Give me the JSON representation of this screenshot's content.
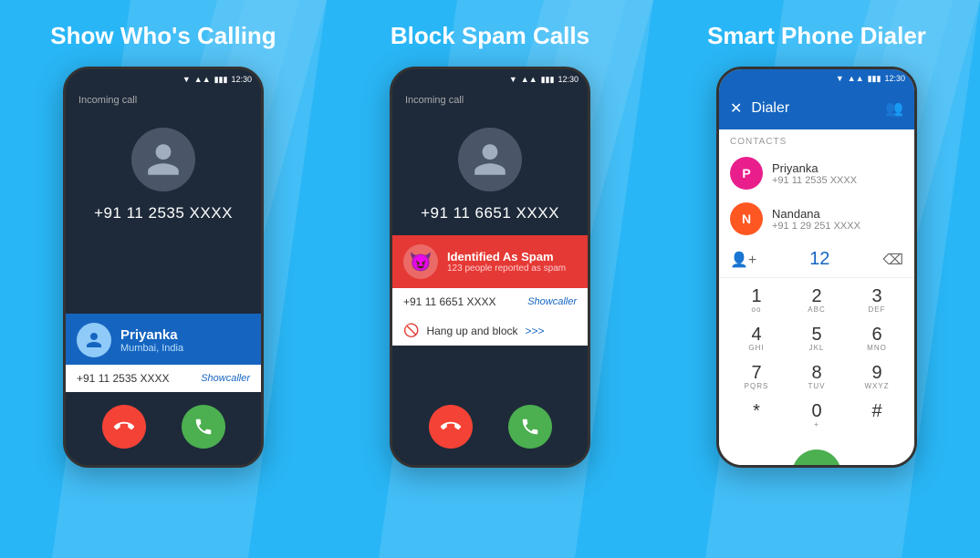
{
  "sections": [
    {
      "title": "Show Who's Calling",
      "phone": {
        "status_time": "12:30",
        "incoming_label": "Incoming call",
        "caller_number": "+91 11 2535 XXXX",
        "caller_name": "Priyanka",
        "caller_location": "Mumbai, India",
        "caller_number_bottom": "+91 11 2535 XXXX",
        "showcaller": "Showcaller"
      }
    },
    {
      "title": "Block Spam Calls",
      "phone": {
        "status_time": "12:30",
        "incoming_label": "Incoming call",
        "caller_number": "+91 11 6651 XXXX",
        "spam_title": "Identified As Spam",
        "spam_subtitle": "123 people reported as spam",
        "caller_number_bottom": "+91 11 6651 XXXX",
        "showcaller": "Showcaller",
        "hangup_text": "Hang up and block",
        "hangup_arrow": ">>>"
      }
    },
    {
      "title": "Smart Phone Dialer",
      "phone": {
        "status_time": "12:30",
        "dialer_title": "Dialer",
        "contacts_label": "CONTACTS",
        "contacts": [
          {
            "name": "Priyanka",
            "number": "+91 11 2535 XXXX",
            "color": "pink",
            "letter": "P"
          },
          {
            "name": "Nandana",
            "number": "+91 1 29 251 XXXX",
            "color": "orange",
            "letter": "N"
          }
        ],
        "input_value": "12",
        "keypad": [
          {
            "main": "1",
            "sub": "oo"
          },
          {
            "main": "2",
            "sub": "ABC"
          },
          {
            "main": "3",
            "sub": "DEF"
          },
          {
            "main": "4",
            "sub": "GHI"
          },
          {
            "main": "5",
            "sub": "JKL"
          },
          {
            "main": "6",
            "sub": "MNO"
          },
          {
            "main": "7",
            "sub": "PQRS"
          },
          {
            "main": "8",
            "sub": "TUV"
          },
          {
            "main": "9",
            "sub": "WXYZ"
          },
          {
            "main": "*",
            "sub": ""
          },
          {
            "main": "0",
            "sub": "+"
          },
          {
            "main": "#",
            "sub": ""
          }
        ]
      }
    }
  ]
}
